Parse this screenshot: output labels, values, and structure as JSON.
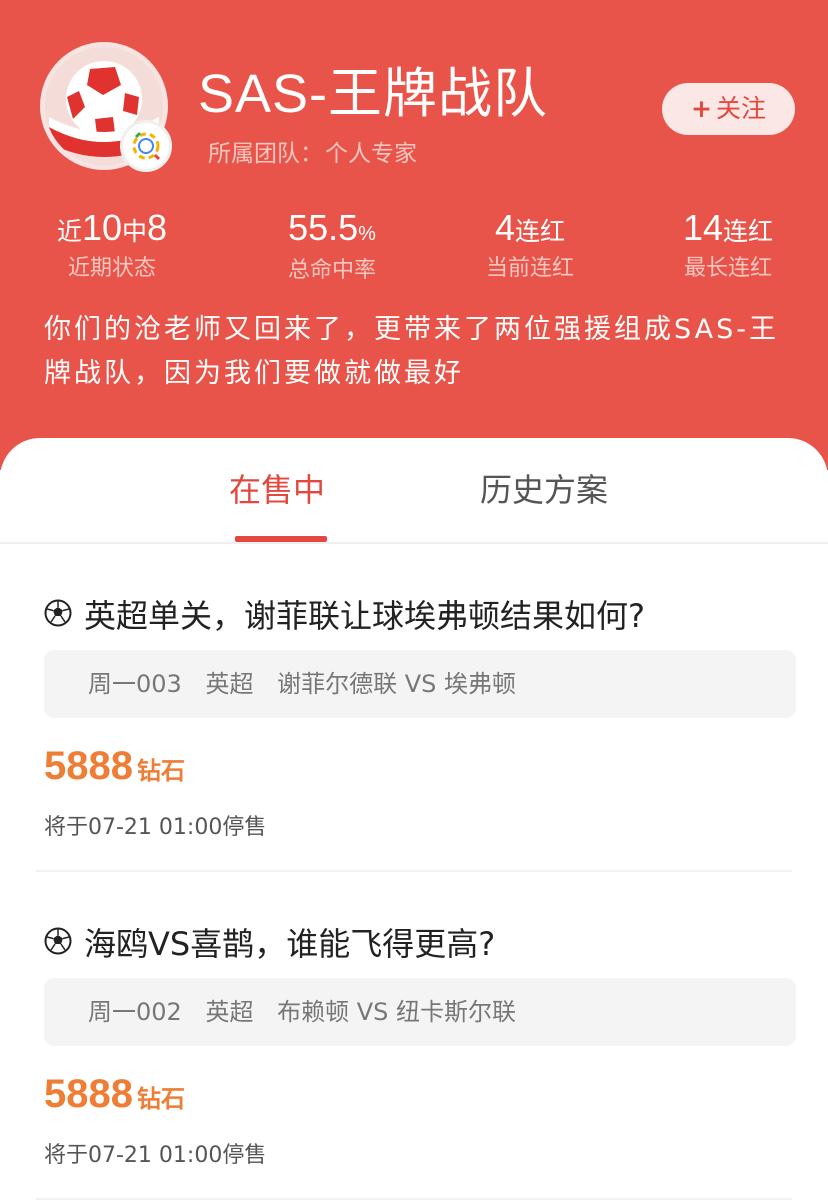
{
  "profile": {
    "name": "SAS-王牌战队",
    "team_label": "所属团队：",
    "team_value": "个人专家",
    "follow": "关注",
    "follow_icon": "plus-icon",
    "intro": "你们的沧老师又回来了，更带来了两位强援组成SAS-王牌战队，因为我们要做就做最好"
  },
  "stats": [
    {
      "p1": "近",
      "p2": "10",
      "p3": "中",
      "p4": "8",
      "label": "近期状态"
    },
    {
      "value": "55.5",
      "unit": "%",
      "label": "总命中率"
    },
    {
      "value": "4",
      "unit": "连红",
      "label": "当前连红"
    },
    {
      "value": "14",
      "unit": "连红",
      "label": "最长连红"
    }
  ],
  "tabs": {
    "active": "在售中",
    "history": "历史方案"
  },
  "plans": [
    {
      "icon": "soccer-ball-icon",
      "title": "英超单关，谢菲联让球埃弗顿结果如何?",
      "match_no": "周一003",
      "league": "英超",
      "teams": "谢菲尔德联 VS 埃弗顿",
      "price": "5888",
      "currency": "钻石",
      "stop": "将于07-21 01:00停售"
    },
    {
      "icon": "soccer-ball-icon",
      "title": "海鸥VS喜鹊，谁能飞得更高?",
      "match_no": "周一002",
      "league": "英超",
      "teams": "布赖顿 VS 纽卡斯尔联",
      "price": "5888",
      "currency": "钻石",
      "stop": "将于07-21 01:00停售"
    }
  ],
  "colors": {
    "header_bg": "#e85449",
    "accent": "#e2483d",
    "price": "#ee7d35"
  }
}
